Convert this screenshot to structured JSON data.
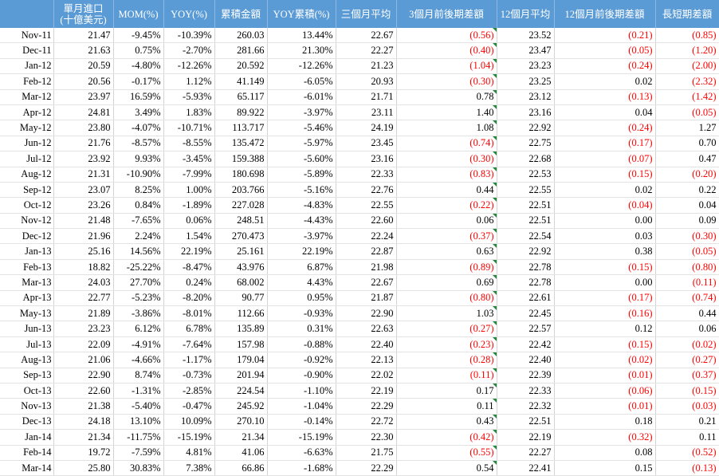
{
  "headers": [
    "單月進口",
    "MOM(%)",
    "YOY(%)",
    "累積金額",
    "YOY累積(%)",
    "三個月平均",
    "3個月前後期差額",
    "12個月平均",
    "12個月前後期差額",
    "長短期差額"
  ],
  "subheader": "(十億美元)",
  "rows": [
    [
      "Nov-11",
      "21.47",
      "-9.45%",
      "-10.39%",
      "260.03",
      "13.44%",
      "22.67",
      "(0.56)",
      "23.52",
      "(0.21)",
      "(0.85)"
    ],
    [
      "Dec-11",
      "21.63",
      "0.75%",
      "-2.70%",
      "281.66",
      "21.30%",
      "22.27",
      "(0.40)",
      "23.47",
      "(0.05)",
      "(1.20)"
    ],
    [
      "Jan-12",
      "20.59",
      "-4.80%",
      "-12.26%",
      "20.592",
      "-12.26%",
      "21.23",
      "(1.04)",
      "23.23",
      "(0.24)",
      "(2.00)"
    ],
    [
      "Feb-12",
      "20.56",
      "-0.17%",
      "1.12%",
      "41.149",
      "-6.05%",
      "20.93",
      "(0.30)",
      "23.25",
      "0.02",
      "(2.32)"
    ],
    [
      "Mar-12",
      "23.97",
      "16.59%",
      "-5.93%",
      "65.117",
      "-6.01%",
      "21.71",
      "0.78",
      "23.12",
      "(0.13)",
      "(1.42)"
    ],
    [
      "Apr-12",
      "24.81",
      "3.49%",
      "1.83%",
      "89.922",
      "-3.97%",
      "23.11",
      "1.40",
      "23.16",
      "0.04",
      "(0.05)"
    ],
    [
      "May-12",
      "23.80",
      "-4.07%",
      "-10.71%",
      "113.717",
      "-5.46%",
      "24.19",
      "1.08",
      "22.92",
      "(0.24)",
      "1.27"
    ],
    [
      "Jun-12",
      "21.76",
      "-8.57%",
      "-8.55%",
      "135.472",
      "-5.97%",
      "23.45",
      "(0.74)",
      "22.75",
      "(0.17)",
      "0.70"
    ],
    [
      "Jul-12",
      "23.92",
      "9.93%",
      "-3.45%",
      "159.388",
      "-5.60%",
      "23.16",
      "(0.30)",
      "22.68",
      "(0.07)",
      "0.47"
    ],
    [
      "Aug-12",
      "21.31",
      "-10.90%",
      "-7.99%",
      "180.698",
      "-5.89%",
      "22.33",
      "(0.83)",
      "22.53",
      "(0.15)",
      "(0.20)"
    ],
    [
      "Sep-12",
      "23.07",
      "8.25%",
      "1.00%",
      "203.766",
      "-5.16%",
      "22.76",
      "0.44",
      "22.55",
      "0.02",
      "0.22"
    ],
    [
      "Oct-12",
      "23.26",
      "0.84%",
      "-1.89%",
      "227.028",
      "-4.83%",
      "22.55",
      "(0.22)",
      "22.51",
      "(0.04)",
      "0.04"
    ],
    [
      "Nov-12",
      "21.48",
      "-7.65%",
      "0.06%",
      "248.51",
      "-4.43%",
      "22.60",
      "0.06",
      "22.51",
      "0.00",
      "0.09"
    ],
    [
      "Dec-12",
      "21.96",
      "2.24%",
      "1.54%",
      "270.473",
      "-3.97%",
      "22.24",
      "(0.37)",
      "22.54",
      "0.03",
      "(0.30)"
    ],
    [
      "Jan-13",
      "25.16",
      "14.56%",
      "22.19%",
      "25.161",
      "22.19%",
      "22.87",
      "0.63",
      "22.92",
      "0.38",
      "(0.05)"
    ],
    [
      "Feb-13",
      "18.82",
      "-25.22%",
      "-8.47%",
      "43.976",
      "6.87%",
      "21.98",
      "(0.89)",
      "22.78",
      "(0.15)",
      "(0.80)"
    ],
    [
      "Mar-13",
      "24.03",
      "27.70%",
      "0.24%",
      "68.002",
      "4.43%",
      "22.67",
      "0.69",
      "22.78",
      "0.00",
      "(0.11)"
    ],
    [
      "Apr-13",
      "22.77",
      "-5.23%",
      "-8.20%",
      "90.77",
      "0.95%",
      "21.87",
      "(0.80)",
      "22.61",
      "(0.17)",
      "(0.74)"
    ],
    [
      "May-13",
      "21.89",
      "-3.86%",
      "-8.01%",
      "112.66",
      "-0.93%",
      "22.90",
      "1.03",
      "22.45",
      "(0.16)",
      "0.44"
    ],
    [
      "Jun-13",
      "23.23",
      "6.12%",
      "6.78%",
      "135.89",
      "0.31%",
      "22.63",
      "(0.27)",
      "22.57",
      "0.12",
      "0.06"
    ],
    [
      "Jul-13",
      "22.09",
      "-4.91%",
      "-7.64%",
      "157.98",
      "-0.88%",
      "22.40",
      "(0.23)",
      "22.42",
      "(0.15)",
      "(0.02)"
    ],
    [
      "Aug-13",
      "21.06",
      "-4.66%",
      "-1.17%",
      "179.04",
      "-0.92%",
      "22.13",
      "(0.28)",
      "22.40",
      "(0.02)",
      "(0.27)"
    ],
    [
      "Sep-13",
      "22.90",
      "8.74%",
      "-0.73%",
      "201.94",
      "-0.90%",
      "22.02",
      "(0.11)",
      "22.39",
      "(0.01)",
      "(0.37)"
    ],
    [
      "Oct-13",
      "22.60",
      "-1.31%",
      "-2.85%",
      "224.54",
      "-1.10%",
      "22.19",
      "0.17",
      "22.33",
      "(0.06)",
      "(0.15)"
    ],
    [
      "Nov-13",
      "21.38",
      "-5.40%",
      "-0.47%",
      "245.92",
      "-1.04%",
      "22.29",
      "0.11",
      "22.32",
      "(0.01)",
      "(0.03)"
    ],
    [
      "Dec-13",
      "24.18",
      "13.10%",
      "10.09%",
      "270.10",
      "-0.14%",
      "22.72",
      "0.43",
      "22.51",
      "0.18",
      "0.21"
    ],
    [
      "Jan-14",
      "21.34",
      "-11.75%",
      "-15.19%",
      "21.34",
      "-15.19%",
      "22.30",
      "(0.42)",
      "22.19",
      "(0.32)",
      "0.11"
    ],
    [
      "Feb-14",
      "19.72",
      "-7.59%",
      "4.81%",
      "41.06",
      "-6.63%",
      "21.75",
      "(0.55)",
      "22.27",
      "0.08",
      "(0.52)"
    ],
    [
      "Mar-14",
      "25.80",
      "30.83%",
      "7.38%",
      "66.86",
      "-1.68%",
      "22.29",
      "0.54",
      "22.41",
      "0.15",
      "(0.13)"
    ]
  ],
  "colors": {
    "header_bg": "#5b9bd5",
    "header_text": "#ffffff",
    "negative": "#ff0000",
    "flag": "#1f8a3a"
  }
}
